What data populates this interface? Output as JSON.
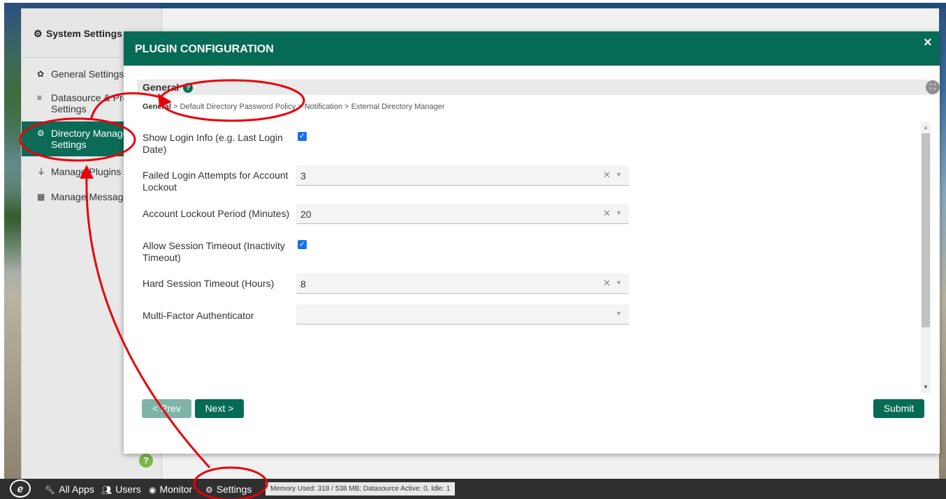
{
  "sidebar": {
    "title": "System Settings",
    "items": [
      {
        "icon": "gear-icon",
        "glyph": "✿",
        "label": "General Settings",
        "active": false
      },
      {
        "icon": "database-icon",
        "glyph": "≡",
        "label": "Datasource & Pro Settings",
        "active": false
      },
      {
        "icon": "users-gear-icon",
        "glyph": "⚙",
        "label": "Directory Manager Settings",
        "active": true
      },
      {
        "icon": "plug-icon",
        "glyph": "⏚",
        "label": "Manage Plugins",
        "active": false
      },
      {
        "icon": "language-icon",
        "glyph": "▦",
        "label": "Manage Messages",
        "active": false
      }
    ],
    "help_label": "?"
  },
  "modal": {
    "title": "PLUGIN CONFIGURATION",
    "close_label": "×",
    "section_title": "General",
    "breadcrumb": {
      "current": "General",
      "rest": "> Default Directory Password Policy > Notification > External Directory Manager"
    },
    "fields": [
      {
        "label": "Show Login Info (e.g. Last Login Date)",
        "type": "checkbox",
        "checked": true
      },
      {
        "label": "Failed Login Attempts for Account Lockout",
        "type": "select",
        "value": "3"
      },
      {
        "label": "Account Lockout Period (Minutes)",
        "type": "select",
        "value": "20"
      },
      {
        "label": "Allow Session Timeout (Inactivity Timeout)",
        "type": "checkbox",
        "checked": true
      },
      {
        "label": "Hard Session Timeout (Hours)",
        "type": "select",
        "value": "8"
      },
      {
        "label": "Multi-Factor Authenticator",
        "type": "select",
        "value": ""
      }
    ],
    "buttons": {
      "prev": "< Prev",
      "next": "Next >",
      "submit": "Submit"
    }
  },
  "taskbar": {
    "items": [
      {
        "icon": "wrench-icon",
        "label": "All Apps"
      },
      {
        "icon": "users-icon",
        "label": "Users"
      },
      {
        "icon": "dashboard-icon",
        "label": "Monitor"
      },
      {
        "icon": "gears-icon",
        "label": "Settings"
      }
    ],
    "status": "Memory Used: 318 / 538 MB; Datasource Active: 0, Idle: 1"
  },
  "colors": {
    "primary": "#066b55",
    "annotation": "#e8000a"
  }
}
